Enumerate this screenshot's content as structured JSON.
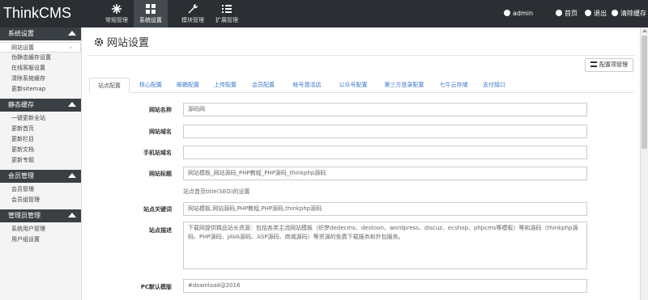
{
  "app": {
    "title": "ThinkCMS"
  },
  "topnav": [
    {
      "label": "常规管理",
      "icon": "asterisk-icon",
      "active": false
    },
    {
      "label": "系统设置",
      "icon": "grid-icon",
      "active": true
    },
    {
      "label": "模块管理",
      "icon": "wrench-icon",
      "active": false
    },
    {
      "label": "扩展管理",
      "icon": "list-icon",
      "active": false
    }
  ],
  "user": {
    "name": "admin",
    "home": "首页",
    "logout": "退出",
    "clear_cache": "清除缓存"
  },
  "sidebar": [
    {
      "title": "系统设置",
      "items": [
        "网站设置",
        "伪静态缓存设置",
        "在线客服设置",
        "清除系统缓存",
        "更新sitemap"
      ]
    },
    {
      "title": "静态缓存",
      "items": [
        "一键更新全站",
        "更新首页",
        "更新栏目",
        "更新文档",
        "更新专题"
      ]
    },
    {
      "title": "会员管理",
      "items": [
        "会员管理",
        "会员组管理"
      ]
    },
    {
      "title": "管理员管理",
      "items": [
        "系统用户管理",
        "用户组设置"
      ]
    }
  ],
  "page": {
    "title": "网站设置",
    "config_button": "配置项管理"
  },
  "tabs": [
    "站点配置",
    "核心配置",
    "邮箱配置",
    "上传配置",
    "会员配置",
    "帐号激活店",
    "公众号配置",
    "第三方登录配置",
    "七牛云存储",
    "支付接口"
  ],
  "form": {
    "site_name": {
      "label": "网站名称",
      "value": "源码网"
    },
    "site_domain": {
      "label": "网站域名",
      "value": ""
    },
    "mobile_domain": {
      "label": "手机站域名",
      "value": ""
    },
    "site_title": {
      "label": "网站标题",
      "value": "网站模板_网站源码_PHP教程_PHP源码_thinkphp源码",
      "hint": "站点首页title(SEO)的设置"
    },
    "site_keywords": {
      "label": "站点关键词",
      "value": "网站模板,网站源码,PHP教程,PHP源码,thinkphp源码"
    },
    "site_desc": {
      "label": "站点描述",
      "value": "下载网提供精品站长资源：包括各类主流网站模板（织梦dedecms、destoon、wordpress、discuz、ecshop、phpcms等模板）等和源码（thinkphp源码、PHP源码、JAVA源码、ASP源码、商城源码）等资源的免费下载服务和外包服务。"
    },
    "pc_template": {
      "label": "PC默认模版",
      "value": "#download@2016"
    }
  }
}
